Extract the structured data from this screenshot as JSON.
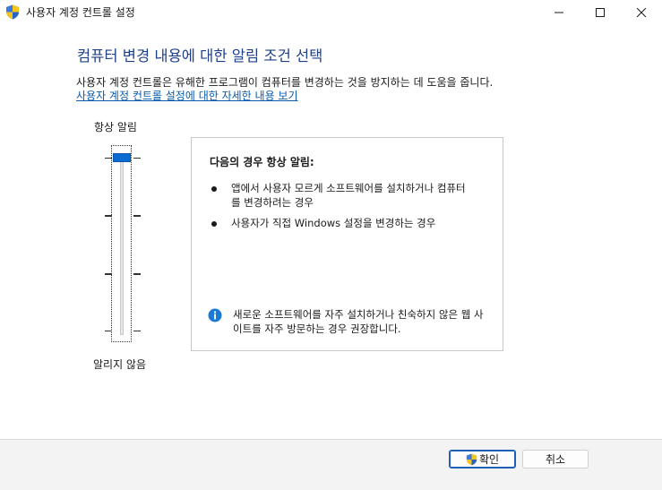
{
  "window": {
    "title": "사용자 계정 컨트롤 설정",
    "icon": "uac-shield-icon"
  },
  "main": {
    "heading": "컴퓨터 변경 내용에 대한 알림 조건 선택",
    "description": "사용자 계정 컨트롤은 유해한 프로그램이 컴퓨터를 변경하는 것을 방지하는 데 도움을 줍니다.",
    "help_link": "사용자 계정 컨트롤 설정에 대한 자세한 내용 보기"
  },
  "slider": {
    "top_label": "항상 알림",
    "bottom_label": "알리지 않음",
    "levels": 4,
    "selected_level": 4
  },
  "info": {
    "title": "다음의 경우 항상 알림:",
    "bullets": [
      "앱에서 사용자 모르게 소프트웨어를 설치하거나 컴퓨터를 변경하려는 경우",
      "사용자가 직접 Windows 설정을 변경하는 경우"
    ],
    "note": "새로운 소프트웨어를 자주 설치하거나 친숙하지 않은 웹 사이트를 자주 방문하는 경우 권장합니다."
  },
  "footer": {
    "ok_label": "확인",
    "cancel_label": "취소"
  },
  "colors": {
    "heading": "#1e3f8c",
    "link": "#0a5bab",
    "thumb": "#0a6cd0",
    "info_icon": "#1a7ad4"
  }
}
